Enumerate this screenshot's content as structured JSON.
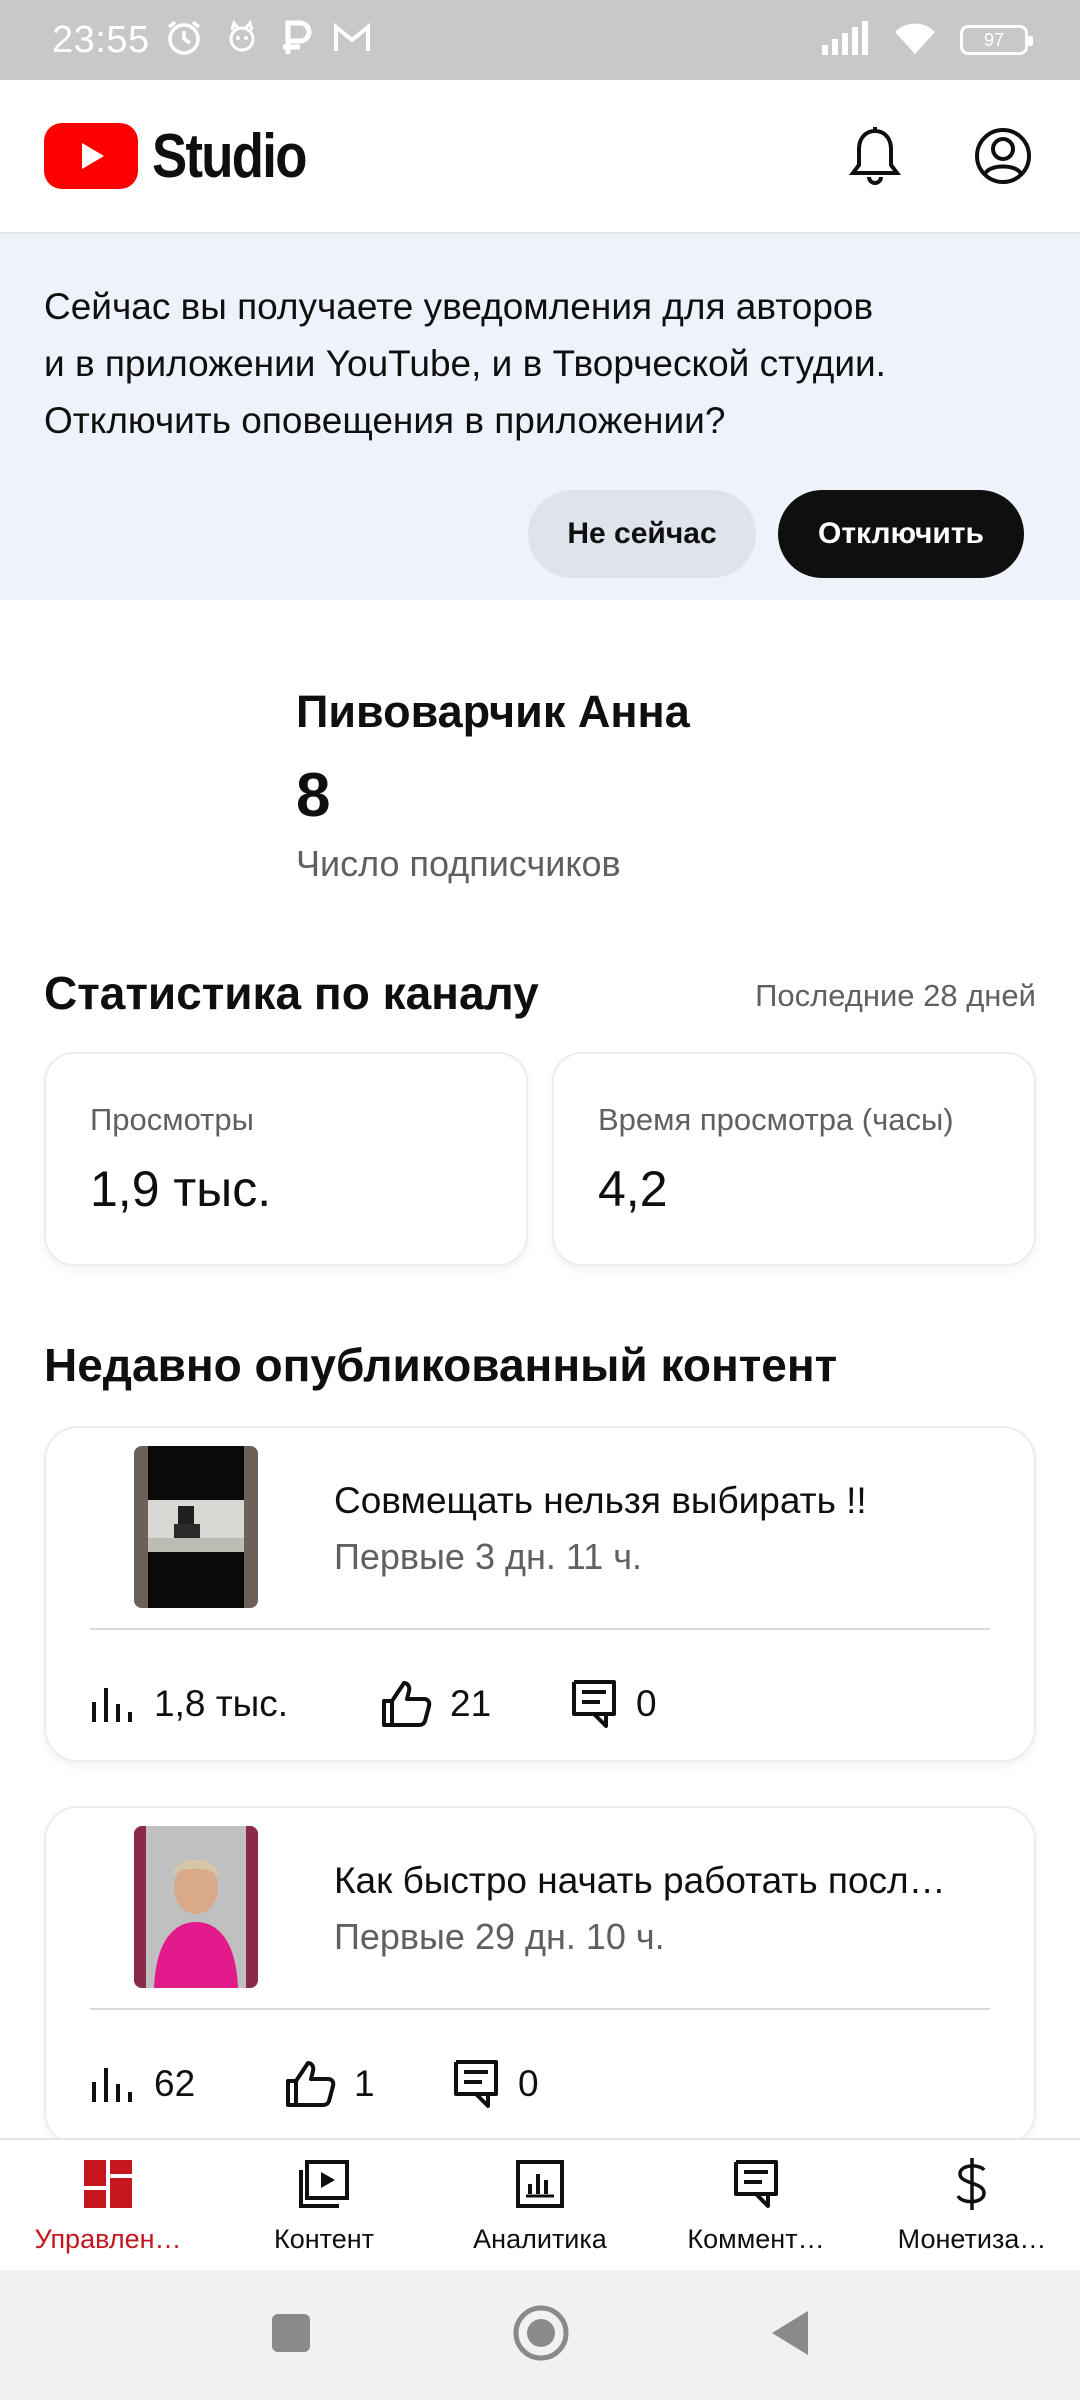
{
  "status_bar": {
    "time": "23:55",
    "battery": "97",
    "icons": [
      "alarm-icon",
      "cat-icon",
      "p-icon",
      "gmail-icon",
      "signal-icon",
      "wifi-icon",
      "battery-icon"
    ]
  },
  "header": {
    "logo_text": "Studio",
    "icons": [
      "youtube-play-icon",
      "bell-icon",
      "account-icon"
    ]
  },
  "banner": {
    "line1": "Сейчас вы получаете уведомления для авторов",
    "line2": "и в приложении YouTube, и в Творческой студии.",
    "line3": "Отключить оповещения в приложении?",
    "not_now_label": "Не сейчас",
    "disable_label": "Отключить"
  },
  "channel": {
    "name": "Пивоварчик Анна",
    "subscribers": "8",
    "subscribers_label": "Число подписчиков"
  },
  "stats": {
    "title": "Статистика по каналу",
    "period": "Последние 28 дней",
    "views_label": "Просмотры",
    "views_value": "1,9 тыс.",
    "watch_time_label": "Время просмотра (часы)",
    "watch_time_value": "4,2"
  },
  "recent": {
    "title": "Недавно опубликованный контент",
    "items": [
      {
        "title": "Совмещать нельзя  выбирать !!",
        "period": "Первые 3 дн. 11 ч.",
        "views": "1,8 тыс.",
        "likes": "21",
        "comments": "0"
      },
      {
        "title": "Как быстро начать работать посл…",
        "period": "Первые 29 дн. 10 ч.",
        "views": "62",
        "likes": "1",
        "comments": "0"
      }
    ]
  },
  "bottom_nav": {
    "items": [
      {
        "label": "Управлен…",
        "icon": "dashboard-icon",
        "active": true
      },
      {
        "label": "Контент",
        "icon": "content-icon",
        "active": false
      },
      {
        "label": "Аналитика",
        "icon": "analytics-icon",
        "active": false
      },
      {
        "label": "Коммент…",
        "icon": "comments-icon",
        "active": false
      },
      {
        "label": "Монетиза…",
        "icon": "dollar-icon",
        "active": false
      }
    ]
  },
  "colors": {
    "accent_red": "#ff0000",
    "active_nav": "#c4161c",
    "banner_bg": "#eef3fb"
  }
}
